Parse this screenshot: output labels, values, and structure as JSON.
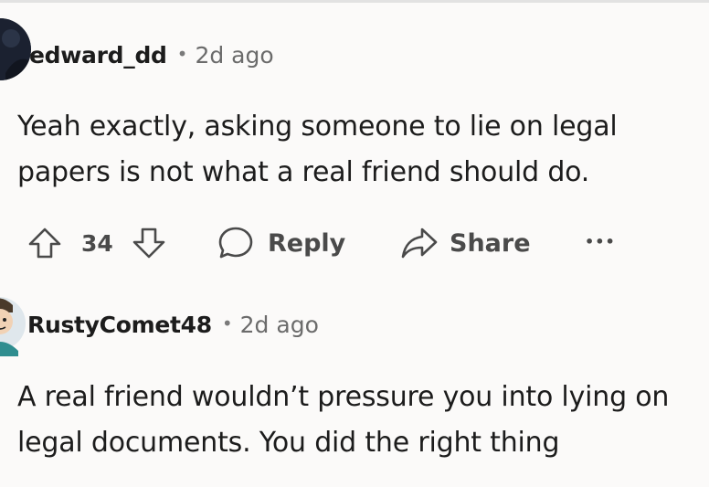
{
  "comments": [
    {
      "username": "edward_dd",
      "separator": "•",
      "time": "2d ago",
      "body": "Yeah exactly, asking someone to lie on legal papers is not what a real friend should do.",
      "actions": {
        "votes": "34",
        "reply_label": "Reply",
        "share_label": "Share",
        "more_label": "•••"
      }
    },
    {
      "username": "RustyComet48",
      "separator": "•",
      "time": "2d ago",
      "body": "A real friend wouldn’t pressure you into lying on legal documents. You did the right thing"
    }
  ],
  "colors": {
    "background": "#fbfaf9",
    "text": "#1c1c1c",
    "muted": "#6b6b6b",
    "avatar1": "#1b2130",
    "avatar2": "#dfe7ec"
  },
  "icons": [
    "upvote-icon",
    "downvote-icon",
    "reply-bubble-icon",
    "share-arrow-icon",
    "more-options-icon"
  ]
}
